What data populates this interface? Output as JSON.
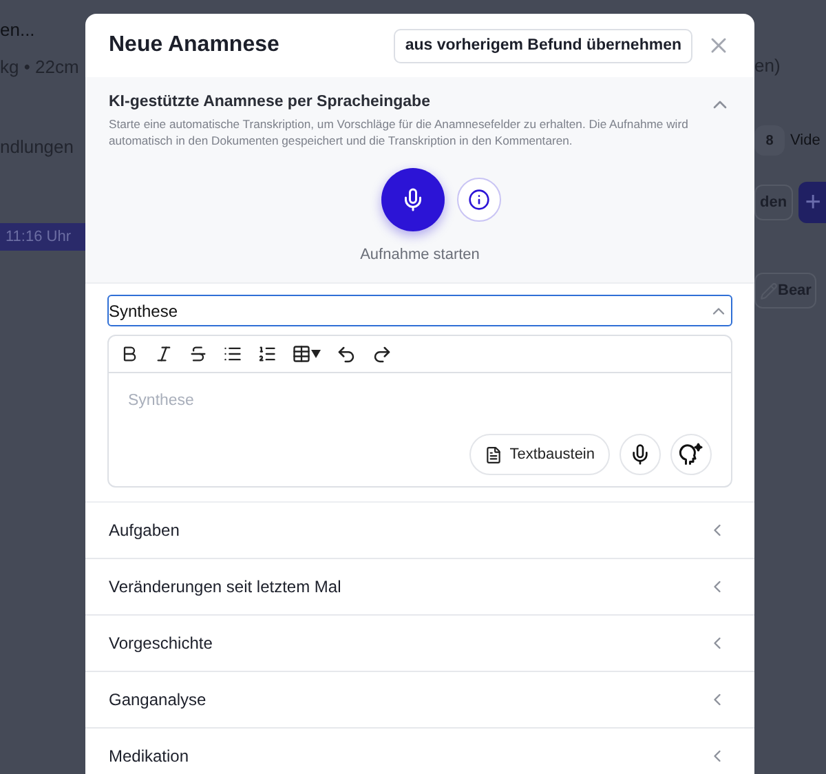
{
  "background_page": {
    "search_placeholder": "en...",
    "patient_info": "kg • 22cm",
    "tab_label": "ndlungen",
    "appointment_time": "11:16 Uhr",
    "info_right": "en)",
    "tab_badge": "8",
    "tab_right": "Vide",
    "button_right": "den",
    "add_button": "+",
    "edit_button": "Bear"
  },
  "modal": {
    "title": "Neue Anamnese",
    "import_button": "aus vorherigem Befund übernehmen",
    "ai_section": {
      "title": "KI-gestützte Anamnese per Spracheingabe",
      "description": "Starte eine automatische Transkription, um Vorschläge für die Anamnesefelder zu erhalten. Die Aufnahme wird automatisch in den Dokumenten gespeichert und die Transkription in den Kommentaren.",
      "expanded": true,
      "record_label": "Aufnahme starten"
    },
    "editor_section": {
      "label": "Synthese",
      "expanded": true,
      "placeholder": "Synthese",
      "snippet_button": "Textbaustein"
    },
    "sections": [
      {
        "label": "Aufgaben",
        "expanded": false
      },
      {
        "label": "Veränderungen seit letztem Mal",
        "expanded": false
      },
      {
        "label": "Vorgeschichte",
        "expanded": false
      },
      {
        "label": "Ganganalyse",
        "expanded": false
      },
      {
        "label": "Medikation",
        "expanded": false
      }
    ]
  }
}
